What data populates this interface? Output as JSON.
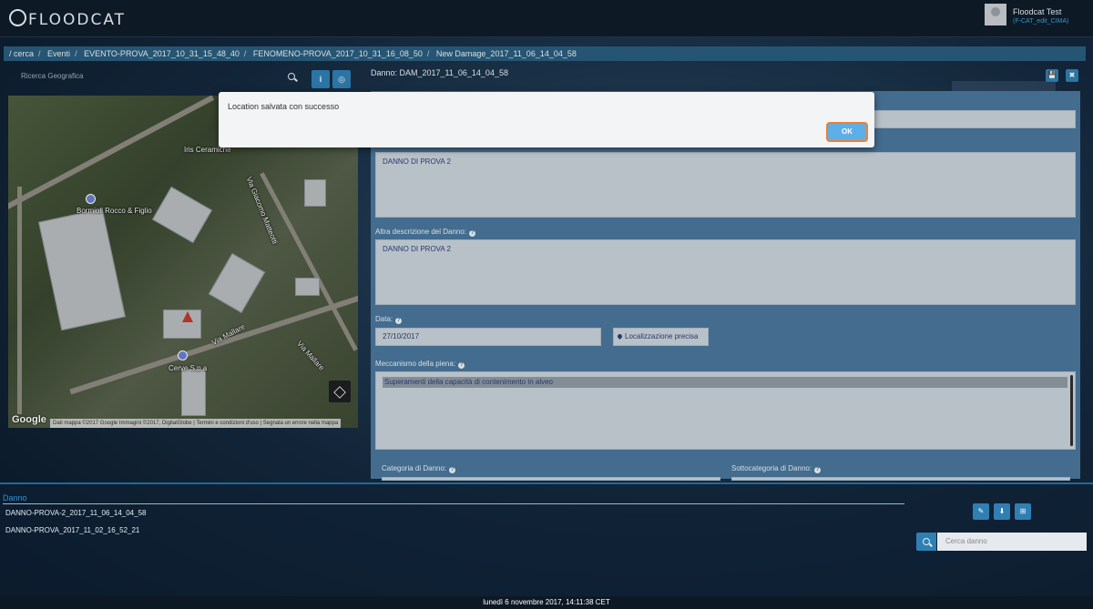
{
  "app": {
    "logo_text": "FLOODCAT"
  },
  "user": {
    "name": "Floodcat Test",
    "sub": "(F-CAT_edit_CIMA)"
  },
  "breadcrumb": [
    "/ cerca",
    "Eventi",
    "EVENTO-PROVA_2017_10_31_15_48_40",
    "FENOMENO-PROVA_2017_10_31_16_08_50",
    "New Damage_2017_11_06_14_04_58"
  ],
  "map": {
    "search_placeholder": "Ricerca Geografica",
    "labels": {
      "iris": "Iris Ceramiche",
      "matteotti": "Via Giacomo Matteotti",
      "bormioli": "Bormioli Rocco & Figlio",
      "mallare1": "Via Mallare",
      "mallare2": "Via Mallare",
      "cerve": "Cerve S.p.a"
    },
    "google": "Google",
    "attribution": "Dati mappa ©2017 Google Immagini ©2017, DigitalGlobe | Termini e condizioni d'uso | Segnala un errore nella mappa"
  },
  "toolbar": {
    "info_label": "i",
    "target_label": "◎",
    "save_label": "💾",
    "close_label": "✖"
  },
  "form": {
    "header": "Danno: DAM_2017_11_06_14_04_58",
    "descrizione_value": "DANNO DI PROVA 2",
    "altra_label": "Altra descrizione del Danno:",
    "altra_value": "DANNO DI PROVA 2",
    "data_label": "Data:",
    "data_value": "27/10/2017",
    "localizzazione_label": "Localizzazione precisa",
    "meccanismo_label": "Meccanismo della piena:",
    "meccanismo_value": "Superamenti della capacità di contenimento in alveo",
    "categoria_label": "Categoria di Danno:",
    "sottocategoria_label": "Sottocategoria di Danno:"
  },
  "modal": {
    "message": "Location salvata con successo",
    "ok_label": "OK"
  },
  "bottom": {
    "title": "Danno",
    "items": [
      "DANNO-PROVA-2_2017_11_06_14_04_58",
      "DANNO-PROVA_2017_11_02_16_52_21"
    ],
    "edit_label": "✎",
    "download_label": "⬇",
    "grid_label": "⊞",
    "search_placeholder": "Cerca danno"
  },
  "footer": {
    "datetime": "lunedì 6 novembre 2017, 14:11:38 CET"
  },
  "colors": {
    "accent": "#2f7fb3",
    "panel": "#49769b",
    "ok_border": "#f08030"
  }
}
